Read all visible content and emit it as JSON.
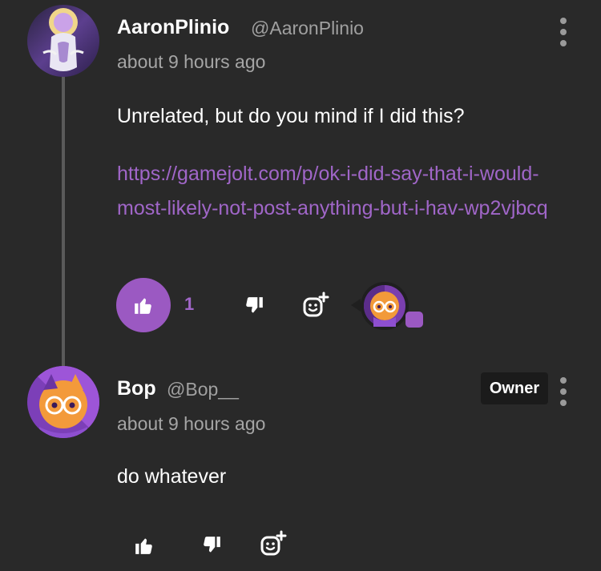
{
  "comments": [
    {
      "username": "AaronPlinio",
      "handle": "@AaronPlinio",
      "time": "about 9 hours ago",
      "text": "Unrelated, but do you mind if I did this?",
      "link": "https://gamejolt.com/p/ok-i-did-say-that-i-would-most-likely-not-post-anything-but-i-hav-wp2vjbcq",
      "likes": "1",
      "liked": true
    },
    {
      "username": "Bop",
      "handle": "@Bop__",
      "time": "about 9 hours ago",
      "badge": "Owner",
      "text": "do whatever"
    }
  ],
  "colors": {
    "background": "#292929",
    "accent": "#9b59c2",
    "link": "#a066c8",
    "muted": "#a5a5a5"
  },
  "icons": [
    "thumbs-up-icon",
    "thumbs-down-icon",
    "add-reaction-icon",
    "more-vertical-icon"
  ]
}
